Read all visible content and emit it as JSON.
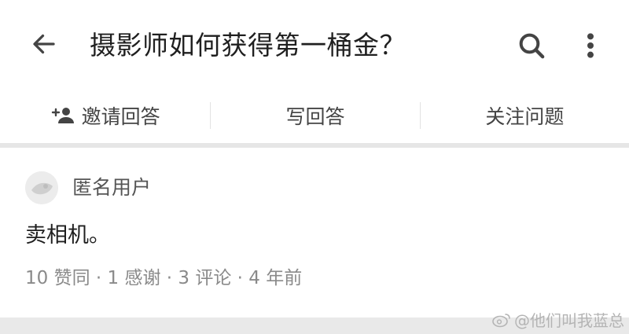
{
  "header": {
    "back_icon": "arrow-left-icon",
    "title": "摄影师如何获得第一桶金？",
    "search_icon": "search-icon",
    "more_icon": "more-vertical-icon"
  },
  "actions": {
    "invite_label": "邀请回答",
    "invite_icon": "add-person-icon",
    "write_label": "写回答",
    "follow_label": "关注问题"
  },
  "answer": {
    "author": "匿名用户",
    "avatar_icon": "anonymous-avatar-icon",
    "content": "卖相机。",
    "meta": "10 赞同 · 1 感谢 · 3 评论 · 4 年前"
  },
  "watermark": {
    "logo_icon": "weibo-logo-icon",
    "text": "@他们叫我蓝总"
  },
  "colors": {
    "text_primary": "#1f1f1f",
    "text_secondary": "#555555",
    "text_meta": "#8a8a8a",
    "divider": "#e6e6e6",
    "icon": "#444444"
  }
}
